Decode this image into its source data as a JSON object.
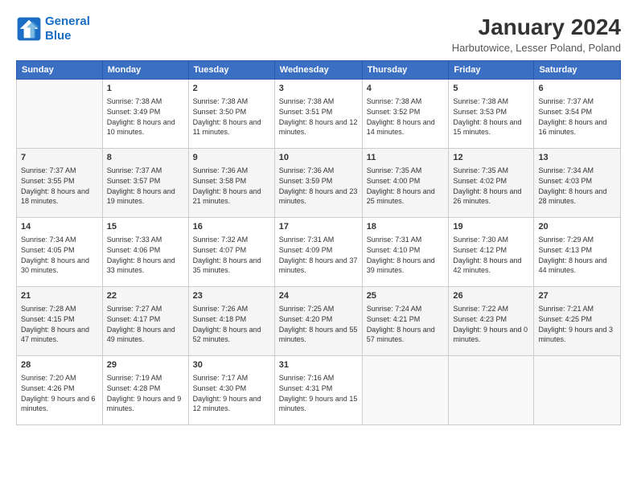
{
  "logo": {
    "line1": "General",
    "line2": "Blue"
  },
  "title": "January 2024",
  "location": "Harbutowice, Lesser Poland, Poland",
  "headers": [
    "Sunday",
    "Monday",
    "Tuesday",
    "Wednesday",
    "Thursday",
    "Friday",
    "Saturday"
  ],
  "weeks": [
    [
      {
        "day": "",
        "sunrise": "",
        "sunset": "",
        "daylight": ""
      },
      {
        "day": "1",
        "sunrise": "Sunrise: 7:38 AM",
        "sunset": "Sunset: 3:49 PM",
        "daylight": "Daylight: 8 hours and 10 minutes."
      },
      {
        "day": "2",
        "sunrise": "Sunrise: 7:38 AM",
        "sunset": "Sunset: 3:50 PM",
        "daylight": "Daylight: 8 hours and 11 minutes."
      },
      {
        "day": "3",
        "sunrise": "Sunrise: 7:38 AM",
        "sunset": "Sunset: 3:51 PM",
        "daylight": "Daylight: 8 hours and 12 minutes."
      },
      {
        "day": "4",
        "sunrise": "Sunrise: 7:38 AM",
        "sunset": "Sunset: 3:52 PM",
        "daylight": "Daylight: 8 hours and 14 minutes."
      },
      {
        "day": "5",
        "sunrise": "Sunrise: 7:38 AM",
        "sunset": "Sunset: 3:53 PM",
        "daylight": "Daylight: 8 hours and 15 minutes."
      },
      {
        "day": "6",
        "sunrise": "Sunrise: 7:37 AM",
        "sunset": "Sunset: 3:54 PM",
        "daylight": "Daylight: 8 hours and 16 minutes."
      }
    ],
    [
      {
        "day": "7",
        "sunrise": "Sunrise: 7:37 AM",
        "sunset": "Sunset: 3:55 PM",
        "daylight": "Daylight: 8 hours and 18 minutes."
      },
      {
        "day": "8",
        "sunrise": "Sunrise: 7:37 AM",
        "sunset": "Sunset: 3:57 PM",
        "daylight": "Daylight: 8 hours and 19 minutes."
      },
      {
        "day": "9",
        "sunrise": "Sunrise: 7:36 AM",
        "sunset": "Sunset: 3:58 PM",
        "daylight": "Daylight: 8 hours and 21 minutes."
      },
      {
        "day": "10",
        "sunrise": "Sunrise: 7:36 AM",
        "sunset": "Sunset: 3:59 PM",
        "daylight": "Daylight: 8 hours and 23 minutes."
      },
      {
        "day": "11",
        "sunrise": "Sunrise: 7:35 AM",
        "sunset": "Sunset: 4:00 PM",
        "daylight": "Daylight: 8 hours and 25 minutes."
      },
      {
        "day": "12",
        "sunrise": "Sunrise: 7:35 AM",
        "sunset": "Sunset: 4:02 PM",
        "daylight": "Daylight: 8 hours and 26 minutes."
      },
      {
        "day": "13",
        "sunrise": "Sunrise: 7:34 AM",
        "sunset": "Sunset: 4:03 PM",
        "daylight": "Daylight: 8 hours and 28 minutes."
      }
    ],
    [
      {
        "day": "14",
        "sunrise": "Sunrise: 7:34 AM",
        "sunset": "Sunset: 4:05 PM",
        "daylight": "Daylight: 8 hours and 30 minutes."
      },
      {
        "day": "15",
        "sunrise": "Sunrise: 7:33 AM",
        "sunset": "Sunset: 4:06 PM",
        "daylight": "Daylight: 8 hours and 33 minutes."
      },
      {
        "day": "16",
        "sunrise": "Sunrise: 7:32 AM",
        "sunset": "Sunset: 4:07 PM",
        "daylight": "Daylight: 8 hours and 35 minutes."
      },
      {
        "day": "17",
        "sunrise": "Sunrise: 7:31 AM",
        "sunset": "Sunset: 4:09 PM",
        "daylight": "Daylight: 8 hours and 37 minutes."
      },
      {
        "day": "18",
        "sunrise": "Sunrise: 7:31 AM",
        "sunset": "Sunset: 4:10 PM",
        "daylight": "Daylight: 8 hours and 39 minutes."
      },
      {
        "day": "19",
        "sunrise": "Sunrise: 7:30 AM",
        "sunset": "Sunset: 4:12 PM",
        "daylight": "Daylight: 8 hours and 42 minutes."
      },
      {
        "day": "20",
        "sunrise": "Sunrise: 7:29 AM",
        "sunset": "Sunset: 4:13 PM",
        "daylight": "Daylight: 8 hours and 44 minutes."
      }
    ],
    [
      {
        "day": "21",
        "sunrise": "Sunrise: 7:28 AM",
        "sunset": "Sunset: 4:15 PM",
        "daylight": "Daylight: 8 hours and 47 minutes."
      },
      {
        "day": "22",
        "sunrise": "Sunrise: 7:27 AM",
        "sunset": "Sunset: 4:17 PM",
        "daylight": "Daylight: 8 hours and 49 minutes."
      },
      {
        "day": "23",
        "sunrise": "Sunrise: 7:26 AM",
        "sunset": "Sunset: 4:18 PM",
        "daylight": "Daylight: 8 hours and 52 minutes."
      },
      {
        "day": "24",
        "sunrise": "Sunrise: 7:25 AM",
        "sunset": "Sunset: 4:20 PM",
        "daylight": "Daylight: 8 hours and 55 minutes."
      },
      {
        "day": "25",
        "sunrise": "Sunrise: 7:24 AM",
        "sunset": "Sunset: 4:21 PM",
        "daylight": "Daylight: 8 hours and 57 minutes."
      },
      {
        "day": "26",
        "sunrise": "Sunrise: 7:22 AM",
        "sunset": "Sunset: 4:23 PM",
        "daylight": "Daylight: 9 hours and 0 minutes."
      },
      {
        "day": "27",
        "sunrise": "Sunrise: 7:21 AM",
        "sunset": "Sunset: 4:25 PM",
        "daylight": "Daylight: 9 hours and 3 minutes."
      }
    ],
    [
      {
        "day": "28",
        "sunrise": "Sunrise: 7:20 AM",
        "sunset": "Sunset: 4:26 PM",
        "daylight": "Daylight: 9 hours and 6 minutes."
      },
      {
        "day": "29",
        "sunrise": "Sunrise: 7:19 AM",
        "sunset": "Sunset: 4:28 PM",
        "daylight": "Daylight: 9 hours and 9 minutes."
      },
      {
        "day": "30",
        "sunrise": "Sunrise: 7:17 AM",
        "sunset": "Sunset: 4:30 PM",
        "daylight": "Daylight: 9 hours and 12 minutes."
      },
      {
        "day": "31",
        "sunrise": "Sunrise: 7:16 AM",
        "sunset": "Sunset: 4:31 PM",
        "daylight": "Daylight: 9 hours and 15 minutes."
      },
      {
        "day": "",
        "sunrise": "",
        "sunset": "",
        "daylight": ""
      },
      {
        "day": "",
        "sunrise": "",
        "sunset": "",
        "daylight": ""
      },
      {
        "day": "",
        "sunrise": "",
        "sunset": "",
        "daylight": ""
      }
    ]
  ]
}
